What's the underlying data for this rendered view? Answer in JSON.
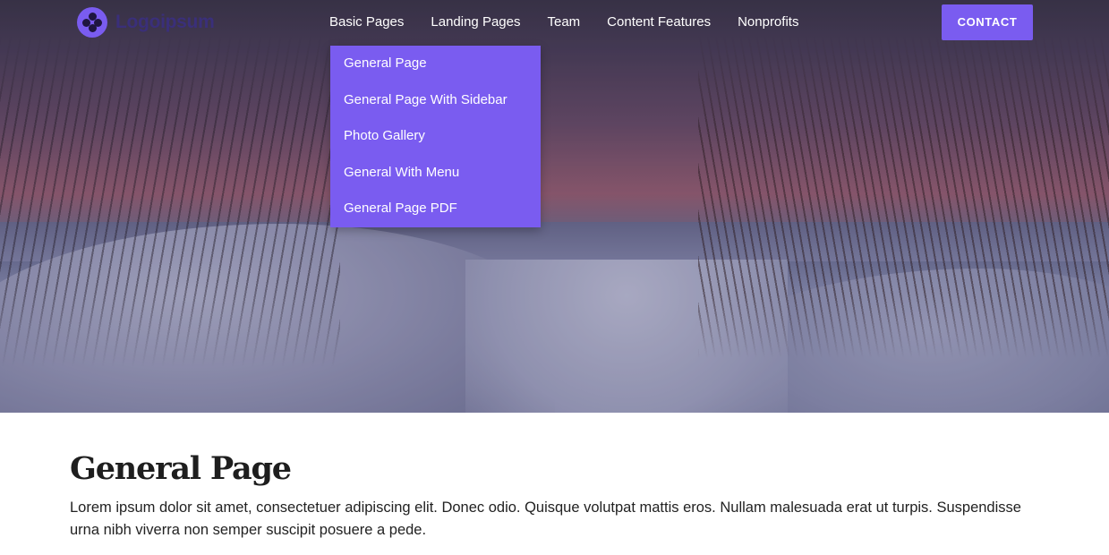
{
  "header": {
    "logo_text": "Logoipsum",
    "nav": [
      {
        "label": "Basic Pages"
      },
      {
        "label": "Landing Pages"
      },
      {
        "label": "Team"
      },
      {
        "label": "Content Features"
      },
      {
        "label": "Nonprofits"
      }
    ],
    "contact_label": "CONTACT"
  },
  "dropdown": {
    "items": [
      {
        "label": "General Page"
      },
      {
        "label": "General Page With Sidebar"
      },
      {
        "label": "Photo Gallery"
      },
      {
        "label": "General With Menu"
      },
      {
        "label": "General Page PDF"
      }
    ]
  },
  "main": {
    "title": "General Page",
    "body": "Lorem ipsum dolor sit amet, consectetuer adipiscing elit. Donec odio. Quisque volutpat mattis eros. Nullam malesuada erat ut turpis. Suspendisse urna nibh viverra non semper suscipit posuere a pede."
  },
  "colors": {
    "accent": "#7a5cf0",
    "text": "#1c1c1c"
  },
  "icons": {
    "logo": "logo-mark-icon"
  }
}
